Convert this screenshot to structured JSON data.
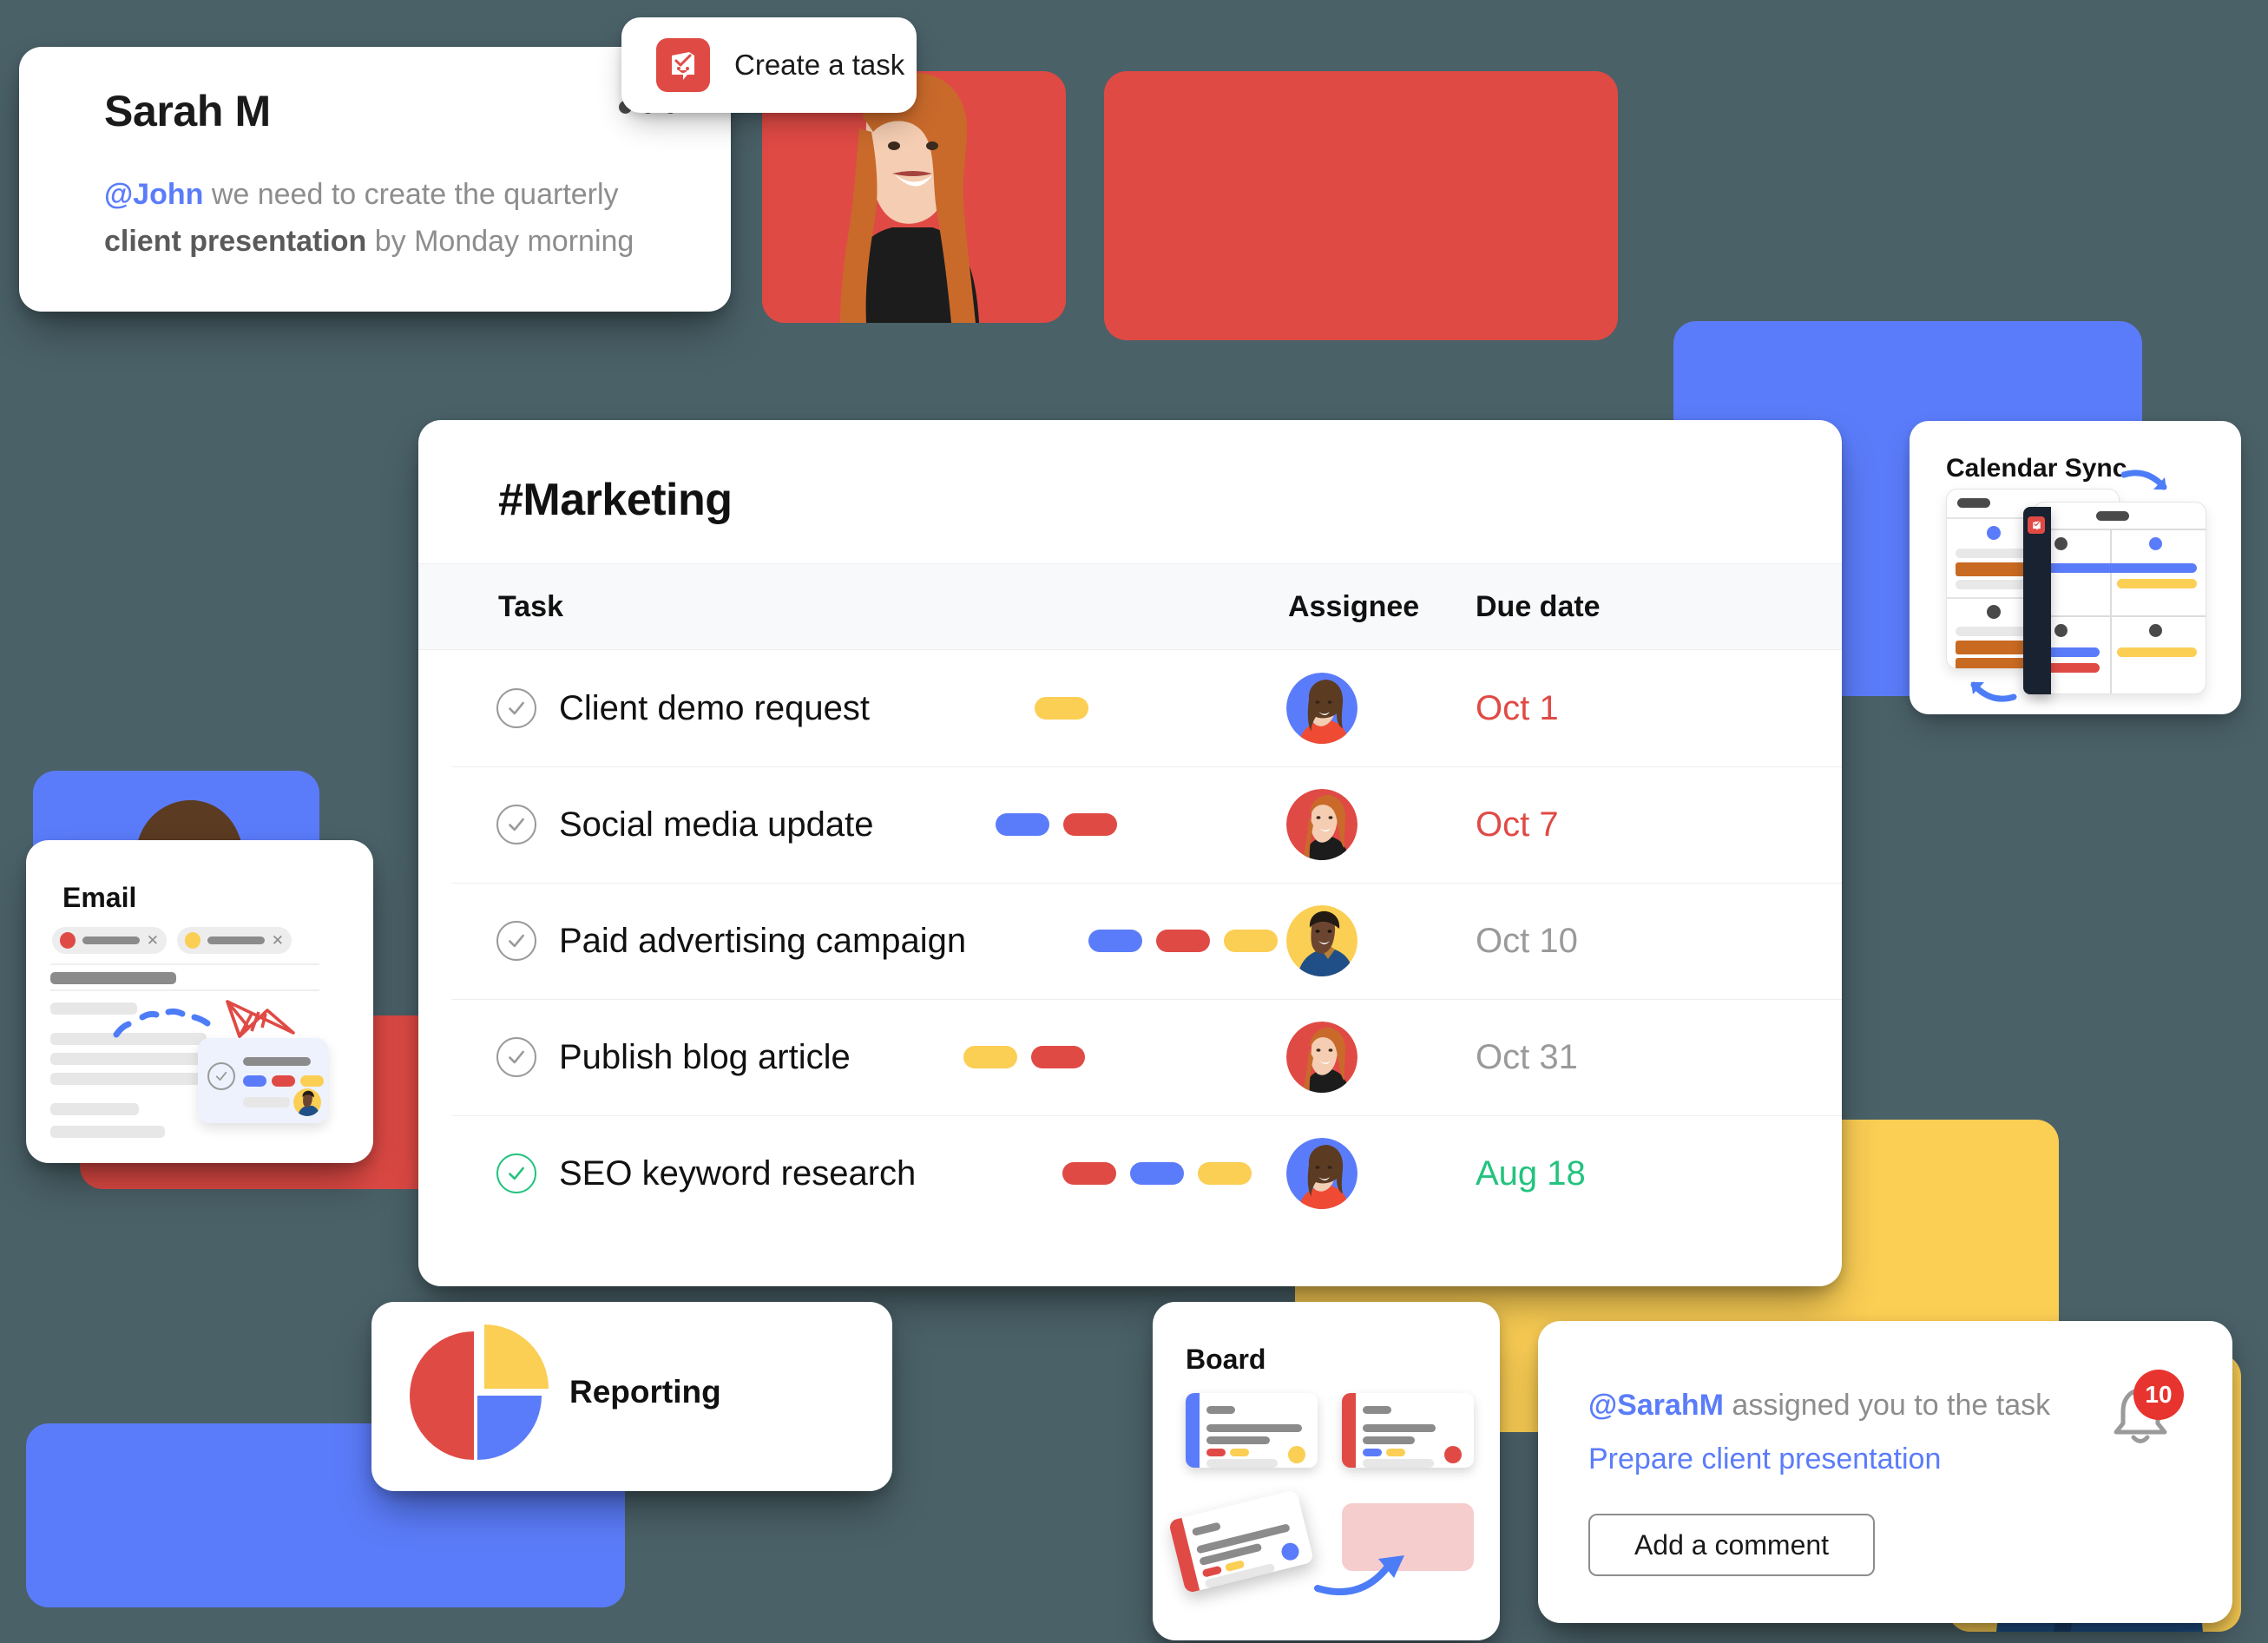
{
  "message_card": {
    "author": "Sarah M",
    "mention": "@John",
    "body_part1": " we need to create the quarterly ",
    "body_strong": "client presentation",
    "body_part2": " by Monday morning",
    "menu_icon": "more-horizontal-icon"
  },
  "create_task": {
    "label": "Create a task",
    "icon": "create-task-icon"
  },
  "marketing": {
    "title": "#Marketing",
    "columns": {
      "task": "Task",
      "assignee": "Assignee",
      "due_date": "Due date"
    },
    "rows": [
      {
        "task": "Client demo request",
        "tags": [
          "yellow"
        ],
        "assignee": "avatar-woman-asian",
        "due": "Oct 1",
        "due_state": "overdue",
        "checked": false
      },
      {
        "task": "Social media update",
        "tags": [
          "blue",
          "red"
        ],
        "assignee": "avatar-woman-red-hair",
        "due": "Oct 7",
        "due_state": "overdue",
        "checked": false
      },
      {
        "task": "Paid advertising campaign",
        "tags": [
          "blue",
          "red",
          "yellow"
        ],
        "assignee": "avatar-man-suit",
        "due": "Oct 10",
        "due_state": "normal",
        "checked": false
      },
      {
        "task": "Publish blog article",
        "tags": [
          "yellow",
          "red"
        ],
        "assignee": "avatar-woman-red-hair",
        "due": "Oct 31",
        "due_state": "normal",
        "checked": false
      },
      {
        "task": "SEO keyword research",
        "tags": [
          "red",
          "blue",
          "yellow"
        ],
        "assignee": "avatar-woman-asian",
        "due": "Aug 18",
        "due_state": "complete",
        "checked": true
      }
    ]
  },
  "email_card": {
    "title": "Email"
  },
  "calendar_card": {
    "title": "Calendar Sync"
  },
  "reporting_card": {
    "title": "Reporting"
  },
  "board_card": {
    "title": "Board"
  },
  "notification": {
    "mention": "@SarahM",
    "text": "  assigned you to the task",
    "task_link": "Prepare client presentation",
    "button_label": "Add a comment",
    "badge_count": "10",
    "bell_icon": "bell-icon"
  },
  "chart_data": {
    "type": "pie",
    "title": "Reporting",
    "labels": [
      "Red segment",
      "Yellow segment",
      "Blue segment"
    ],
    "values": [
      50,
      25,
      25
    ],
    "colors": [
      "#e04a45",
      "#fbce54",
      "#5b7cfa"
    ],
    "legend": "none",
    "exploded": [
      "Yellow segment"
    ]
  },
  "palette": {
    "background": "#4a6168",
    "red": "#e04a45",
    "blue": "#5b7cfa",
    "yellow": "#fbce54",
    "green": "#23c37f",
    "grey_text": "#8d8d8d"
  }
}
